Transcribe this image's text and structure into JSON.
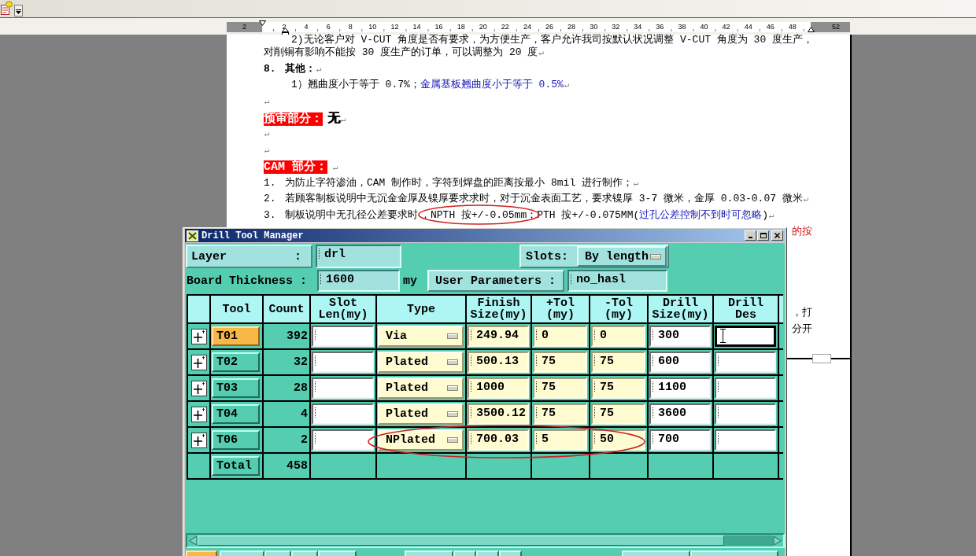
{
  "ruler": {
    "left_label": "2",
    "labels": [
      "2",
      "4",
      "6",
      "8",
      "10",
      "12",
      "14",
      "16",
      "18",
      "20",
      "22",
      "24",
      "26",
      "28",
      "30",
      "32",
      "34",
      "36",
      "38",
      "40",
      "42",
      "44",
      "46",
      "48"
    ],
    "right_label": "52"
  },
  "document": {
    "paragraphs": [
      {
        "kind": "sub_item",
        "segments": [
          {
            "kind": "text",
            "text": "2)无论客户对 V-CUT 角度是否有要求，为方便生产，客户允许我司按默认状况调整 V-CUT 角度为 30 度生产，"
          }
        ]
      },
      {
        "kind": "plain",
        "segments": [
          {
            "kind": "text",
            "text": "对削铜有影响不能按 30 度生产的订单，可以调整为 20 度"
          },
          {
            "kind": "mark",
            "text": "↵"
          }
        ]
      },
      {
        "kind": "heading",
        "number": "8.",
        "segments": [
          {
            "kind": "text",
            "text": "其他："
          },
          {
            "kind": "mark",
            "text": "↵"
          }
        ]
      },
      {
        "kind": "sub_item",
        "segments": [
          {
            "kind": "text",
            "text": "1）翘曲度小于等于 0.7%；"
          },
          {
            "kind": "blue",
            "text": "金属基板翘曲度小于等于 0.5%"
          },
          {
            "kind": "mark",
            "text": "↵"
          }
        ]
      },
      {
        "kind": "empty",
        "segments": [
          {
            "kind": "mark",
            "text": "↵"
          }
        ]
      },
      {
        "kind": "title",
        "segments": [
          {
            "kind": "highlight",
            "text": "预审部分："
          },
          {
            "kind": "text",
            "text": "无"
          },
          {
            "kind": "mark",
            "text": "↵"
          }
        ]
      },
      {
        "kind": "empty",
        "segments": [
          {
            "kind": "mark",
            "text": "↵"
          }
        ]
      },
      {
        "kind": "empty",
        "segments": [
          {
            "kind": "mark",
            "text": "↵"
          }
        ]
      },
      {
        "kind": "title",
        "segments": [
          {
            "kind": "highlight",
            "text": "CAM 部分："
          },
          {
            "kind": "mark",
            "text": "↵"
          }
        ]
      },
      {
        "kind": "list_item",
        "number": "1.",
        "segments": [
          {
            "kind": "text",
            "text": "为防止字符渗油，CAM 制作时，字符到焊盘的距离按最小 8mil 进行制作；"
          },
          {
            "kind": "mark",
            "text": "↵"
          }
        ]
      },
      {
        "kind": "list_item",
        "number": "2.",
        "segments": [
          {
            "kind": "text",
            "text": "若顾客制板说明中无沉金金厚及镍厚要求求时，对于沉金表面工艺，要求镍厚 3-7 微米，金厚 0.03-0.07 微米"
          },
          {
            "kind": "mark",
            "text": "↵"
          }
        ]
      },
      {
        "kind": "list_item",
        "number": "3.",
        "segments": [
          {
            "kind": "text",
            "text": "制板说明中无孔径公差要求时"
          },
          {
            "kind": "circled",
            "text": "，NPTH 按+/-0.05mm；"
          },
          {
            "kind": "text",
            "text": "PTH 按+/-0.075MM("
          },
          {
            "kind": "blue",
            "text": "过孔公差控制不到时可忽略"
          },
          {
            "kind": "text",
            "text": ")"
          },
          {
            "kind": "mark",
            "text": "↵"
          }
        ]
      }
    ],
    "covered_lines": [
      {
        "kind": "red",
        "text": "的按"
      },
      {
        "kind": "text",
        "text": "，打"
      },
      {
        "kind": "text",
        "text": "分开"
      }
    ]
  },
  "dialog": {
    "title": "Drill Tool Manager",
    "layer": {
      "label": "Layer",
      "colon": ":",
      "value": "drl"
    },
    "slots": {
      "label": "Slots:",
      "value": "By length"
    },
    "board_thickness": {
      "label": "Board Thickness :",
      "value": "1600",
      "unit": "my"
    },
    "user_parameters": {
      "label": "User Parameters :",
      "value": "no_hasl"
    },
    "table": {
      "columns": [
        "Tool",
        "Count",
        "Slot Len(my)",
        "Type",
        "Finish Size(my)",
        "+Tol (my)",
        "-Tol (my)",
        "Drill Size(my)",
        "Drill Des"
      ],
      "rows": [
        {
          "tool": "T01",
          "selected": true,
          "count": "392",
          "type": "Via",
          "finish_size": "249.94",
          "plus_tol": "0",
          "minus_tol": "0",
          "drill_size": "300",
          "focused": true,
          "circled": false
        },
        {
          "tool": "T02",
          "selected": false,
          "count": "32",
          "type": "Plated",
          "finish_size": "500.13",
          "plus_tol": "75",
          "minus_tol": "75",
          "drill_size": "600",
          "focused": false,
          "circled": false
        },
        {
          "tool": "T03",
          "selected": false,
          "count": "28",
          "type": "Plated",
          "finish_size": "1000",
          "plus_tol": "75",
          "minus_tol": "75",
          "drill_size": "1100",
          "focused": false,
          "circled": false
        },
        {
          "tool": "T04",
          "selected": false,
          "count": "4",
          "type": "Plated",
          "finish_size": "3500.12",
          "plus_tol": "75",
          "minus_tol": "75",
          "drill_size": "3600",
          "focused": false,
          "circled": false
        },
        {
          "tool": "T06",
          "selected": false,
          "count": "2",
          "type": "NPlated",
          "finish_size": "700.03",
          "plus_tol": "5",
          "minus_tol": "50",
          "drill_size": "700",
          "focused": false,
          "circled": true
        }
      ],
      "total": {
        "label": "Total",
        "count": "458"
      }
    },
    "bottom_buttons": [
      {
        "selected": true
      },
      {
        "selected": false
      },
      {
        "selected": false
      },
      {
        "selected": false
      },
      {
        "selected": false
      },
      {
        "selected": false
      },
      {
        "selected": false
      },
      {
        "selected": false
      },
      {
        "selected": false
      },
      {
        "selected": false
      },
      {
        "selected": false
      }
    ]
  }
}
